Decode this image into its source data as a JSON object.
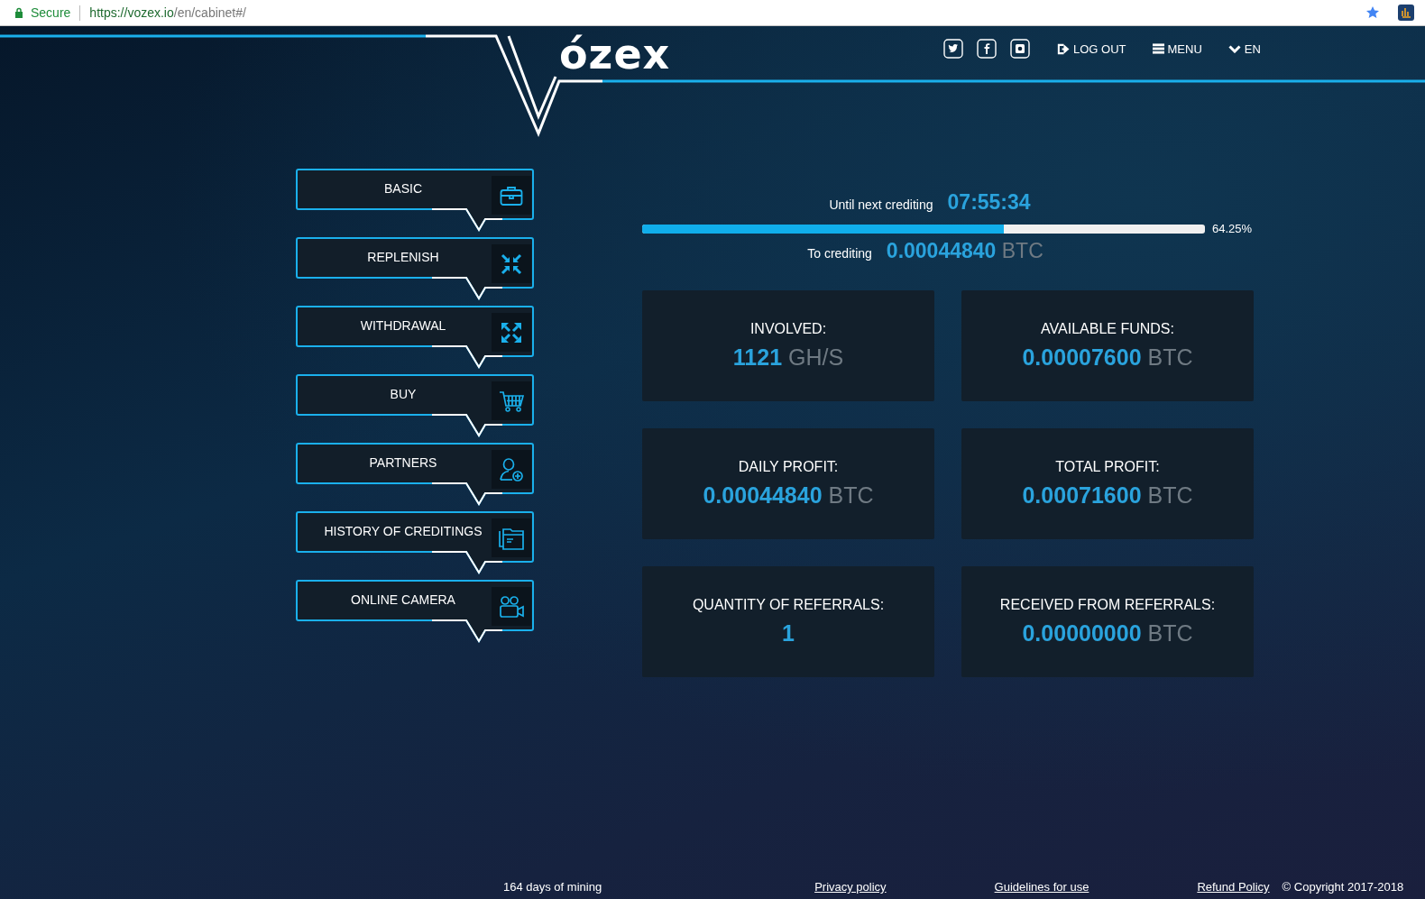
{
  "browser": {
    "secure_label": "Secure",
    "url_host": "https://vozex.io",
    "url_path": "/en/cabinet#/"
  },
  "header": {
    "logo_text": "ózex",
    "nav": [
      {
        "label": "LOG OUT"
      },
      {
        "label": "MENU"
      },
      {
        "label": "EN"
      }
    ]
  },
  "menu": [
    {
      "label": "BASIC"
    },
    {
      "label": "REPLENISH"
    },
    {
      "label": "WITHDRAWAL"
    },
    {
      "label": "BUY"
    },
    {
      "label": "PARTNERS"
    },
    {
      "label": "HISTORY OF CREDITINGS"
    },
    {
      "label": "ONLINE CAMERA"
    }
  ],
  "crediting": {
    "timer_label": "Until next crediting",
    "timer": "07:55:34",
    "level": 0.6425,
    "percent": "64.25%",
    "amount_label": "To crediting",
    "amount": "0.00044840",
    "unit": "BTC"
  },
  "stats": [
    {
      "label": "INVOLVED:",
      "value": "1121",
      "unit": "GH/S"
    },
    {
      "label": "AVAILABLE FUNDS:",
      "value": "0.00007600",
      "unit": "BTC"
    },
    {
      "label": "DAILY PROFIT:",
      "value": "0.00044840",
      "unit": "BTC"
    },
    {
      "label": "TOTAL PROFIT:",
      "value": "0.00071600",
      "unit": "BTC"
    },
    {
      "label": "QUANTITY OF REFERRALS:",
      "value": "1"
    },
    {
      "label": "RECEIVED FROM REFERRALS:",
      "value": "0.00000000",
      "unit": "BTC"
    }
  ],
  "footer": {
    "mining_days": "164 days of mining",
    "links": [
      "Privacy policy",
      "Guidelines for use",
      "Refund Policy"
    ],
    "copyright": "© Copyright 2017-2018"
  }
}
